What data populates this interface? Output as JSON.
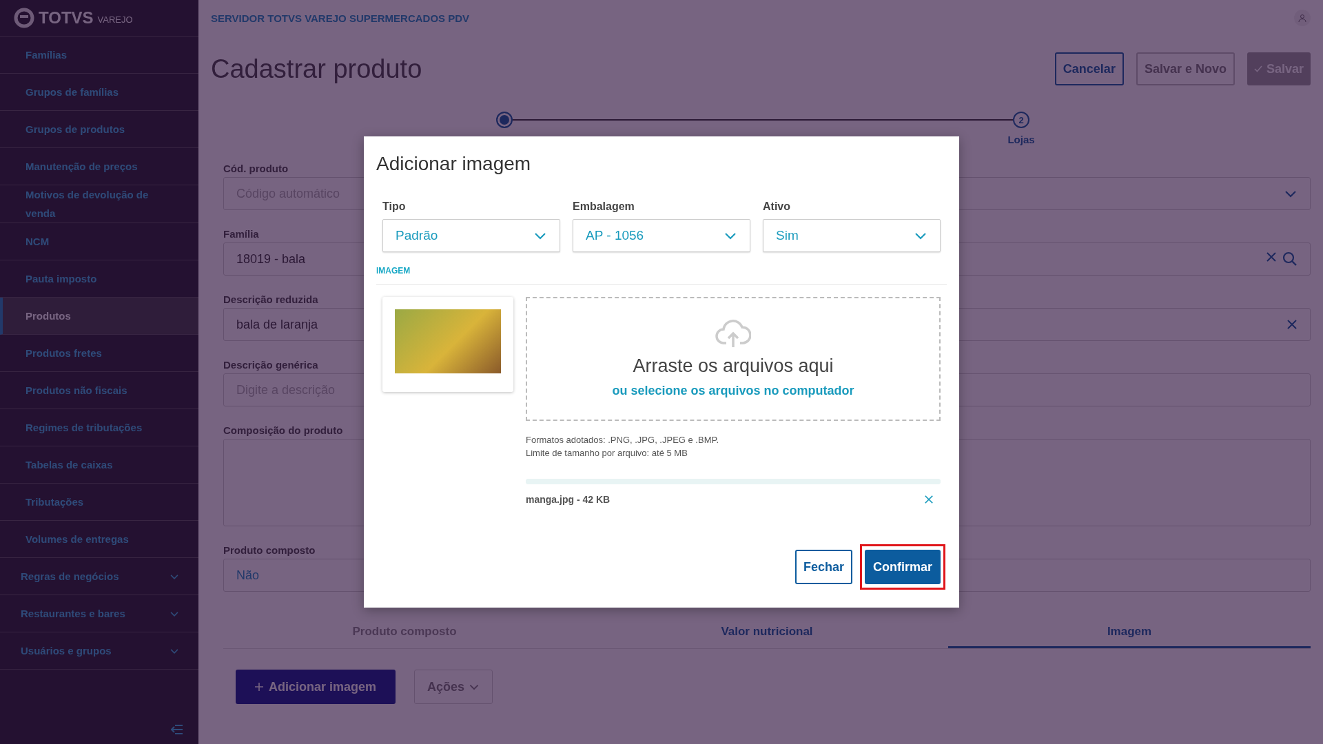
{
  "brand": {
    "name": "TOTVS",
    "product": "VAREJO"
  },
  "sidebar": {
    "items": [
      {
        "label": "Famílias",
        "kind": "link",
        "selected": false
      },
      {
        "label": "Grupos de famílias",
        "kind": "link",
        "selected": false
      },
      {
        "label": "Grupos de produtos",
        "kind": "link",
        "selected": false
      },
      {
        "label": "Manutenção de preços",
        "kind": "link",
        "selected": false
      },
      {
        "label": "Motivos de devolução de venda",
        "kind": "link",
        "selected": false
      },
      {
        "label": "NCM",
        "kind": "link",
        "selected": false
      },
      {
        "label": "Pauta imposto",
        "kind": "link",
        "selected": false
      },
      {
        "label": "Produtos",
        "kind": "link",
        "selected": true
      },
      {
        "label": "Produtos fretes",
        "kind": "link",
        "selected": false
      },
      {
        "label": "Produtos não fiscais",
        "kind": "link",
        "selected": false
      },
      {
        "label": "Regimes de tributações",
        "kind": "link",
        "selected": false
      },
      {
        "label": "Tabelas de caixas",
        "kind": "link",
        "selected": false
      },
      {
        "label": "Tributações",
        "kind": "link",
        "selected": false
      },
      {
        "label": "Volumes de entregas",
        "kind": "link",
        "selected": false
      },
      {
        "label": "Regras de negócios",
        "kind": "group",
        "selected": false
      },
      {
        "label": "Restaurantes e bares",
        "kind": "group",
        "selected": false
      },
      {
        "label": "Usuários e grupos",
        "kind": "group",
        "selected": false
      }
    ]
  },
  "header": {
    "server": "SERVIDOR TOTVS VAREJO SUPERMERCADOS PDV"
  },
  "page": {
    "title": "Cadastrar produto",
    "actions": [
      {
        "label": "Cancelar",
        "kind": "outline",
        "disabled": false
      },
      {
        "label": "Salvar e Novo",
        "kind": "outline",
        "disabled": true
      },
      {
        "label": "Salvar",
        "kind": "primary",
        "disabled": true
      }
    ]
  },
  "stepper": {
    "steps": [
      {
        "selected": true
      },
      {
        "number": "2",
        "label": "Lojas",
        "selected": false
      }
    ]
  },
  "form": {
    "fields": [
      {
        "label": "Cód. produto",
        "kind": "select",
        "placeholder": "Código automático"
      },
      {
        "label": "Família",
        "kind": "search",
        "value": "18019 - bala"
      },
      {
        "label": "Descrição reduzida",
        "kind": "text",
        "value": "bala de laranja",
        "clearable": true
      },
      {
        "label": "Descrição genérica",
        "kind": "text",
        "placeholder": "Digite a descrição",
        "clearable": false
      },
      {
        "label": "Composição do produto",
        "kind": "textarea"
      },
      {
        "label": "Produto composto",
        "kind": "choice",
        "value": "Não"
      }
    ]
  },
  "tabs": [
    {
      "label": "Produto composto",
      "selected": false,
      "disabled": true
    },
    {
      "label": "Valor nutricional",
      "selected": false,
      "disabled": false
    },
    {
      "label": "Imagem",
      "selected": true,
      "disabled": false
    }
  ],
  "toolbar": {
    "add": "Adicionar imagem",
    "actions": {
      "label": "Ações",
      "disabled": true
    }
  },
  "modal": {
    "title": "Adicionar imagem",
    "selects": [
      {
        "label": "Tipo",
        "value": "Padrão"
      },
      {
        "label": "Embalagem",
        "value": "AP - 1056"
      },
      {
        "label": "Ativo",
        "value": "Sim"
      }
    ],
    "section": "IMAGEM",
    "upload": {
      "title": "Arraste os arquivos aqui",
      "link": "ou selecione os arquivos no computador",
      "hints": [
        "Formatos adotados: .PNG, .JPG, .JPEG e .BMP.",
        "Limite de tamanho por arquivo: até 5 MB"
      ]
    },
    "file": {
      "name": "manga.jpg - 42 KB",
      "level": 1
    },
    "buttons": [
      {
        "label": "Fechar",
        "kind": "secondary",
        "highlighted": false
      },
      {
        "label": "Confirmar",
        "kind": "primary",
        "highlighted": true
      }
    ]
  }
}
